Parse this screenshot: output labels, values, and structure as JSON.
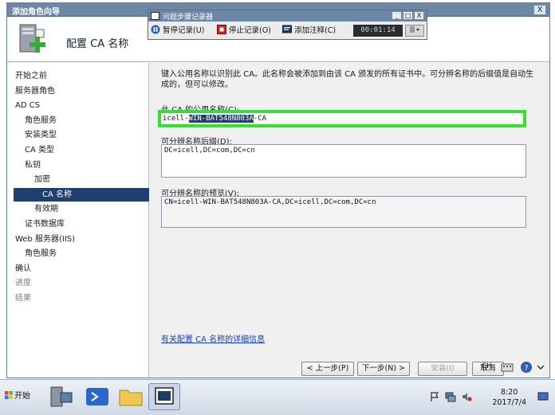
{
  "window": {
    "title": "添加角色向导",
    "close_glyph": "X"
  },
  "header": {
    "heading": "配置 CA 名称"
  },
  "nav": {
    "items": [
      {
        "label": "开始之前",
        "level": 0,
        "state": "normal"
      },
      {
        "label": "服务器角色",
        "level": 0,
        "state": "normal"
      },
      {
        "label": "AD CS",
        "level": 0,
        "state": "normal"
      },
      {
        "label": "角色服务",
        "level": 1,
        "state": "normal"
      },
      {
        "label": "安装类型",
        "level": 1,
        "state": "normal"
      },
      {
        "label": "CA 类型",
        "level": 1,
        "state": "normal"
      },
      {
        "label": "私钥",
        "level": 1,
        "state": "normal"
      },
      {
        "label": "加密",
        "level": 2,
        "state": "normal"
      },
      {
        "label": "CA 名称",
        "level": 2,
        "state": "selected"
      },
      {
        "label": "有效期",
        "level": 2,
        "state": "normal"
      },
      {
        "label": "证书数据库",
        "level": 1,
        "state": "normal"
      },
      {
        "label": "Web 服务器(IIS)",
        "level": 0,
        "state": "normal"
      },
      {
        "label": "角色服务",
        "level": 1,
        "state": "normal"
      },
      {
        "label": "确认",
        "level": 0,
        "state": "normal"
      },
      {
        "label": "进度",
        "level": 0,
        "state": "dim"
      },
      {
        "label": "结果",
        "level": 0,
        "state": "dim"
      }
    ]
  },
  "content": {
    "intro": "键入公用名称以识别此 CA。此名称会被添加到由该 CA 颁发的所有证书中。可分辨名称的后缀值是自动生成的，但可以修改。",
    "common_name_label": "此 CA 的公用名称(C):",
    "common_name_prefix": "icell-",
    "common_name_selected": "WIN-BAT548N803A",
    "common_name_suffix": "-CA",
    "dn_suffix_label": "可分辨名称后缀(D):",
    "dn_suffix_value": "DC=icell,DC=com,DC=cn",
    "preview_label": "可分辨名称的预览(V):",
    "preview_value": "CN=icell-WIN-BAT548N803A-CA,DC=icell,DC=com,DC=cn",
    "more_info_link": "有关配置 CA 名称的详细信息"
  },
  "buttons": {
    "back": "< 上一步(P)",
    "next": "下一步(N) >",
    "install": "安装(I)",
    "cancel": "取消"
  },
  "recorder": {
    "title": "问题步骤记录器",
    "pause": "暂停记录(U)",
    "stop": "停止记录(O)",
    "add_comment": "添加注释(C)",
    "timer": "00:01:14",
    "win_min": "_",
    "win_max": "□",
    "win_close": "X"
  },
  "taskbar": {
    "start_label": "开始",
    "time": "8:20",
    "date": "2017/7/4",
    "tray_labels": [
      "CH"
    ]
  },
  "colors": {
    "highlight_box": "#35e02d",
    "selection": "#1f3f6e",
    "titlebar": "#6d87a6",
    "link": "#1a3fa8"
  }
}
